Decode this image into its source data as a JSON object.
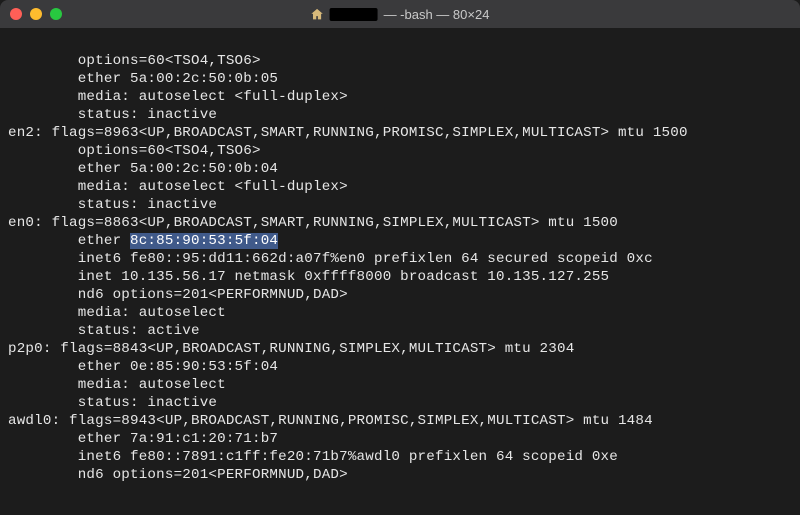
{
  "title": {
    "text": "— -bash — 80×24"
  },
  "lines": {
    "l1": "        options=60<TSO4,TSO6>",
    "l2": "        ether 5a:00:2c:50:0b:05",
    "l3": "        media: autoselect <full-duplex>",
    "l4": "        status: inactive",
    "l5": "en2: flags=8963<UP,BROADCAST,SMART,RUNNING,PROMISC,SIMPLEX,MULTICAST> mtu 1500",
    "l6": "        options=60<TSO4,TSO6>",
    "l7": "        ether 5a:00:2c:50:0b:04",
    "l8": "        media: autoselect <full-duplex>",
    "l9": "        status: inactive",
    "l10": "en0: flags=8863<UP,BROADCAST,SMART,RUNNING,SIMPLEX,MULTICAST> mtu 1500",
    "l11a": "        ether ",
    "l11b": "8c:85:90:53:5f:04",
    "l12": "        inet6 fe80::95:dd11:662d:a07f%en0 prefixlen 64 secured scopeid 0xc",
    "l13": "        inet 10.135.56.17 netmask 0xffff8000 broadcast 10.135.127.255",
    "l14": "        nd6 options=201<PERFORMNUD,DAD>",
    "l15": "        media: autoselect",
    "l16": "        status: active",
    "l17": "p2p0: flags=8843<UP,BROADCAST,RUNNING,SIMPLEX,MULTICAST> mtu 2304",
    "l18": "        ether 0e:85:90:53:5f:04",
    "l19": "        media: autoselect",
    "l20": "        status: inactive",
    "l21": "awdl0: flags=8943<UP,BROADCAST,RUNNING,PROMISC,SIMPLEX,MULTICAST> mtu 1484",
    "l22": "        ether 7a:91:c1:20:71:b7",
    "l23": "        inet6 fe80::7891:c1ff:fe20:71b7%awdl0 prefixlen 64 scopeid 0xe",
    "l24": "        nd6 options=201<PERFORMNUD,DAD>"
  }
}
